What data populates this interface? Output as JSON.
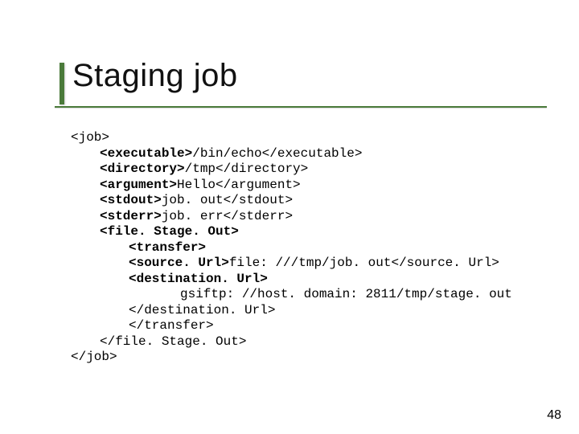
{
  "slide": {
    "title": "Staging job",
    "page_number": "48"
  },
  "code": {
    "lines": [
      {
        "indent": "t0",
        "segments": [
          {
            "t": "<job>",
            "b": false
          }
        ]
      },
      {
        "indent": "t1",
        "segments": [
          {
            "t": "<executable>",
            "b": true
          },
          {
            "t": "/bin/echo",
            "b": false
          },
          {
            "t": "</executable>",
            "b": false
          }
        ]
      },
      {
        "indent": "t1",
        "segments": [
          {
            "t": "<directory>",
            "b": true
          },
          {
            "t": "/tmp",
            "b": false
          },
          {
            "t": "</directory>",
            "b": false
          }
        ]
      },
      {
        "indent": "t1",
        "segments": [
          {
            "t": "<argument>",
            "b": true
          },
          {
            "t": "Hello",
            "b": false
          },
          {
            "t": "</argument>",
            "b": false
          }
        ]
      },
      {
        "indent": "t1",
        "segments": [
          {
            "t": "<stdout>",
            "b": true
          },
          {
            "t": "job. out",
            "b": false
          },
          {
            "t": "</stdout>",
            "b": false
          }
        ]
      },
      {
        "indent": "t1",
        "segments": [
          {
            "t": "<stderr>",
            "b": true
          },
          {
            "t": "job. err",
            "b": false
          },
          {
            "t": "</stderr>",
            "b": false
          }
        ]
      },
      {
        "indent": "t1",
        "segments": [
          {
            "t": "<file. Stage. Out>",
            "b": true
          }
        ]
      },
      {
        "indent": "t2",
        "segments": [
          {
            "t": "<transfer>",
            "b": true
          }
        ]
      },
      {
        "indent": "t2",
        "segments": [
          {
            "t": "<source. Url>",
            "b": true
          },
          {
            "t": "file: ///tmp/job. out",
            "b": false
          },
          {
            "t": "</source. Url>",
            "b": false
          }
        ]
      },
      {
        "indent": "t2",
        "segments": [
          {
            "t": "<destination. Url>",
            "b": true
          }
        ]
      },
      {
        "indent": "t3",
        "segments": [
          {
            "t": "gsiftp: //host. domain: 2811/tmp/stage. out",
            "b": false
          }
        ]
      },
      {
        "indent": "t2",
        "segments": [
          {
            "t": "</destination. Url>",
            "b": false
          }
        ]
      },
      {
        "indent": "t2",
        "segments": [
          {
            "t": "</transfer>",
            "b": false
          }
        ]
      },
      {
        "indent": "t1",
        "segments": [
          {
            "t": "</file. Stage. Out>",
            "b": false
          }
        ]
      },
      {
        "indent": "t0",
        "segments": [
          {
            "t": "</job>",
            "b": false
          }
        ]
      }
    ]
  }
}
